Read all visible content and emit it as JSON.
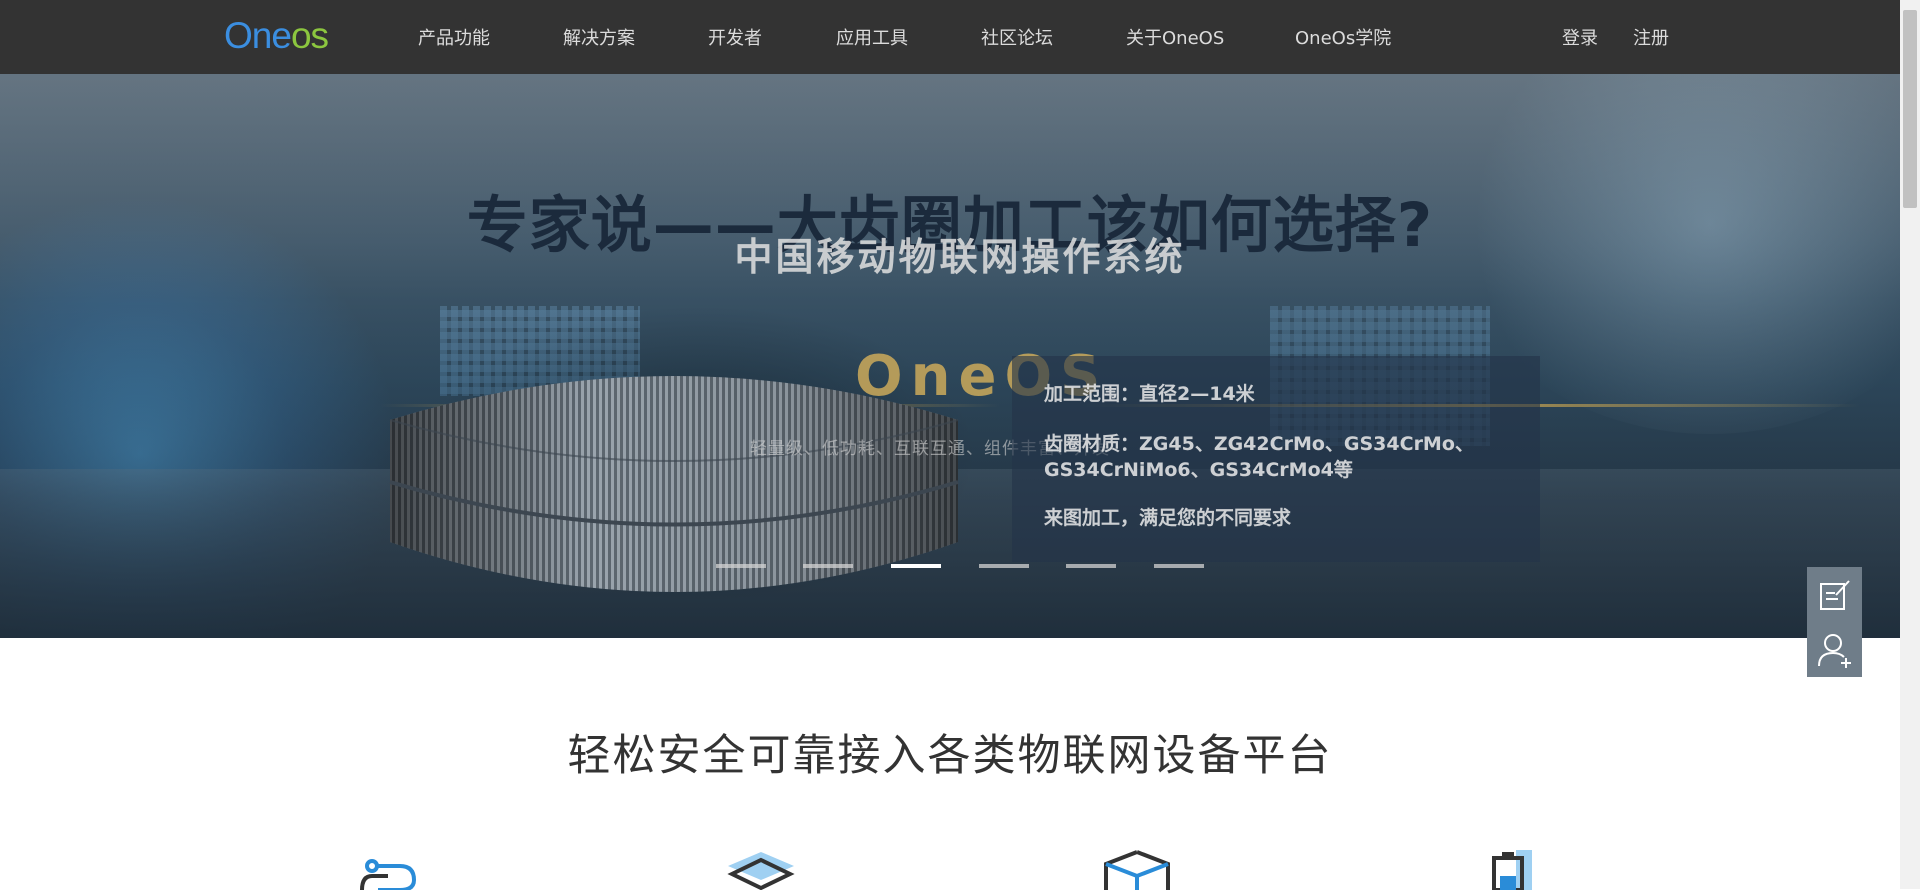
{
  "nav": {
    "logo": {
      "part1": "O",
      "part2": "ne",
      "part3": "os"
    },
    "items": [
      {
        "label": "产品功能"
      },
      {
        "label": "解决方案"
      },
      {
        "label": "开发者"
      },
      {
        "label": "应用工具"
      },
      {
        "label": "社区论坛"
      },
      {
        "label": "关于OneOS"
      },
      {
        "label": "OneOs学院"
      }
    ],
    "login_label": "登录",
    "register_label": "注册"
  },
  "hero": {
    "title": "专家说——大齿圈加工该如何选择?",
    "subtitle": "中国移动物联网操作系统",
    "brand": "OneOS",
    "tagline": "轻量级、低功耗、互联互通、组件丰富、开发",
    "info": {
      "line1": "加工范围：直径2—14米",
      "line2": "齿圈材质：ZG45、ZG42CrMo、GS34CrMo、",
      "line3": "GS34CrNiMo6、GS34CrMo4等",
      "line4": "来图加工，满足您的不同要求"
    },
    "slides": {
      "count": 6,
      "active_index": 2
    }
  },
  "side_panel": {
    "icons": [
      "feedback-icon",
      "add-user-icon"
    ]
  },
  "section": {
    "title": "轻松安全可靠接入各类物联网设备平台"
  },
  "colors": {
    "nav_bg": "#333333",
    "logo_blue": "#3b8ee0",
    "logo_green": "#8cc63f",
    "side_panel_bg": "#6f7d89",
    "icon_blue": "#2a8cd8"
  }
}
